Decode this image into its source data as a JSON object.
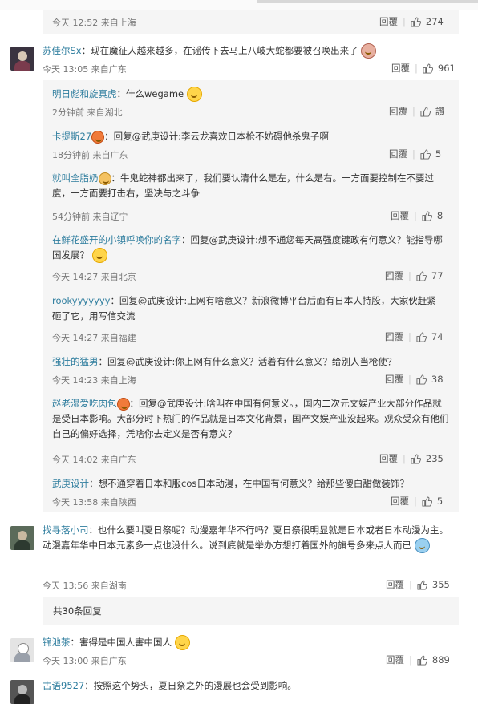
{
  "ui": {
    "reply_label": "回覆",
    "like_icon": "thumb-up-icon"
  },
  "first_meta": {
    "time": "今天 12:52 来自上海",
    "likes": "274"
  },
  "c1": {
    "name": "苏佳尔Sx",
    "text": "：现在魔征人越来越多，在谣传下去马上八岐大蛇都要被召唤出来了",
    "time": "今天 13:05 来自广东",
    "likes": "961"
  },
  "s1": {
    "name": "明日彪和旋真虎",
    "text": "：什么wegame",
    "time": "2分钟前 来自湖北",
    "likes": "讚"
  },
  "s2": {
    "name": "卡提斯27",
    "text": "：回复@武庚设计:李云龙喜欢日本枪不妨碍他杀鬼子啊",
    "time": "18分钟前 来自广东",
    "likes": "5"
  },
  "s3": {
    "name": "就叫全脂奶",
    "text": "：牛鬼蛇神都出来了，我们要认清什么是左，什么是右。一方面要控制在不要过度，一方面要打击右，坚决与之斗争",
    "time": "54分钟前 来自辽宁",
    "likes": "8"
  },
  "s4": {
    "name": "在鲜花盛开的小镇呼唤你的名字",
    "text": "：回复@武庚设计:想不通您每天高强度键政有何意义？能指导哪国发展？",
    "time": "今天 14:27 来自北京",
    "likes": "77"
  },
  "s5": {
    "name": "rookyyyyyyy",
    "text": "：回复@武庚设计:上网有啥意义？新浪微博平台后面有日本人持股，大家伙赶紧砸了它，用写信交流",
    "time": "今天 14:27 来自福建",
    "likes": "74"
  },
  "s6": {
    "name": "强壮的猛男",
    "text": "：回复@武庚设计:你上网有什么意义？活着有什么意义？给别人当枪使？",
    "time": "今天 14:23 来自上海",
    "likes": "38"
  },
  "s7": {
    "name": "赵老湿爱吃肉包",
    "text": "：回复@武庚设计:啥叫在中国有何意义。，国内二次元文娱产业大部分作品就是受日本影响。大部分时下热门的作品就是日本文化背景，国产文娱产业没起来。观众受众有他们自己的偏好选择，凭啥你去定义是否有意义？",
    "time": "今天 14:02 来自广东",
    "likes": "235"
  },
  "s8": {
    "name": "武庚设计",
    "text": "：想不通穿着日本和服cos日本动漫，在中国有何意义？给那些傻白甜做装饰？",
    "time": "今天 13:58 来自陕西",
    "likes": "5"
  },
  "c2": {
    "name": "找寻落小司",
    "text": "：也什么要叫夏日祭呢？动漫嘉年华不行吗？夏日祭很明显就是日本或者日本动漫为主。动漫嘉年华中日本元素多一点也没什么。说到底就是举办方想打着国外的旗号多来点人而已",
    "time": "今天 13:56 来自湖南",
    "likes": "355"
  },
  "more": {
    "label": "共30条回复"
  },
  "c3": {
    "name": "锦池茶",
    "text": "：害得是中国人害中国人",
    "time": "今天 13:00 来自广东",
    "likes": "889"
  },
  "c4": {
    "name": "古语9527",
    "text": "：按照这个势头，夏日祭之外的漫展也会受到影响。"
  }
}
